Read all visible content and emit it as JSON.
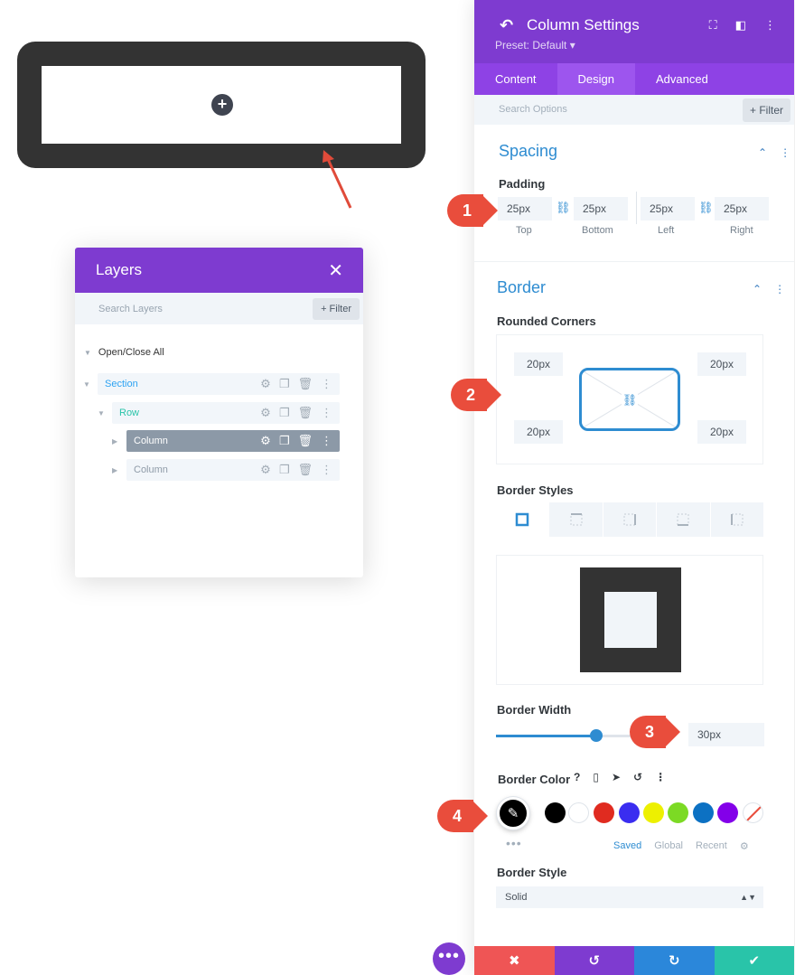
{
  "canvas": {
    "add_icon": "+"
  },
  "layers": {
    "title": "Layers",
    "close_icon": "✕",
    "search_placeholder": "Search Layers",
    "filter_label": "+ Filter",
    "open_close_all": "Open/Close All",
    "items": [
      {
        "label": "Section"
      },
      {
        "label": "Row"
      },
      {
        "label": "Column"
      },
      {
        "label": "Column"
      }
    ]
  },
  "panel": {
    "title": "Column Settings",
    "preset": "Preset: Default ▾",
    "tabs": [
      {
        "label": "Content"
      },
      {
        "label": "Design"
      },
      {
        "label": "Advanced"
      }
    ],
    "search_placeholder": "Search Options",
    "filter_label": "+ Filter",
    "spacing": {
      "title": "Spacing",
      "padding_label": "Padding",
      "fields": [
        {
          "value": "25px",
          "label": "Top"
        },
        {
          "value": "25px",
          "label": "Bottom"
        },
        {
          "value": "25px",
          "label": "Left"
        },
        {
          "value": "25px",
          "label": "Right"
        }
      ]
    },
    "border": {
      "title": "Border",
      "rounded_label": "Rounded Corners",
      "corners": {
        "tl": "20px",
        "tr": "20px",
        "bl": "20px",
        "br": "20px"
      },
      "styles_label": "Border Styles",
      "width_label": "Border Width",
      "width_value": "30px",
      "width_fraction": 0.65,
      "color_label": "Border Color",
      "color_icon_q": "?",
      "swatches": [
        "#000000",
        "#ffffff",
        "#e02b20",
        "#3a2df0",
        "#edf000",
        "#7cda24",
        "#0c71c3",
        "#8300e9"
      ],
      "palette_tabs": [
        {
          "label": "Saved"
        },
        {
          "label": "Global"
        },
        {
          "label": "Recent"
        }
      ],
      "style_label": "Border Style",
      "style_value": "Solid"
    },
    "footer_colors": [
      "#ef5555",
      "#7e3bd0",
      "#2b87da",
      "#29c4a9"
    ]
  },
  "fab_label": "•••",
  "badges": [
    "1",
    "2",
    "3",
    "4"
  ]
}
